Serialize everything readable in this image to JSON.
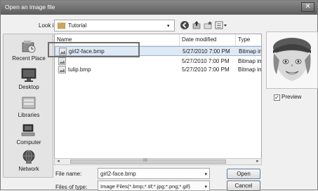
{
  "window": {
    "title": "Open an image file",
    "close_label": "✕"
  },
  "look_in": {
    "label": "Look in:",
    "value": "Tutorial"
  },
  "columns": {
    "name": "Name",
    "date": "Date modified",
    "type": "Type"
  },
  "files": [
    {
      "name": "girl2-face.bmp",
      "date": "5/27/2010 7:00 PM",
      "type": "Bitmap im",
      "selected": true
    },
    {
      "name": "",
      "date": "5/27/2010 7:00 PM",
      "type": "Bitmap im",
      "selected": false
    },
    {
      "name": "tulip.bmp",
      "date": "5/27/2010 7:00 PM",
      "type": "Bitmap im",
      "selected": false
    }
  ],
  "places": [
    {
      "label": "Recent Place",
      "icon": "recent-places-icon"
    },
    {
      "label": "Desktop",
      "icon": "desktop-icon"
    },
    {
      "label": "Libraries",
      "icon": "libraries-icon"
    },
    {
      "label": "Computer",
      "icon": "computer-icon"
    },
    {
      "label": "Network",
      "icon": "network-icon"
    }
  ],
  "scrollbar": {
    "left": "◂",
    "right": "▸",
    "grip": "III"
  },
  "preview": {
    "label": "Preview",
    "checked": true,
    "check_mark": "✓"
  },
  "file_name": {
    "label": "File name:",
    "value": "girl2-face.bmp"
  },
  "file_type": {
    "label": "Files of type:",
    "value": "Image Files(*.bmp;*.tif;*.jpg;*.png;*.gif)"
  },
  "buttons": {
    "open": "Open",
    "cancel": "Cancel"
  },
  "arrow_glyph": "▾",
  "colors": {
    "title_bar": "#6e6e6e",
    "selection": "#dfe9f5"
  }
}
